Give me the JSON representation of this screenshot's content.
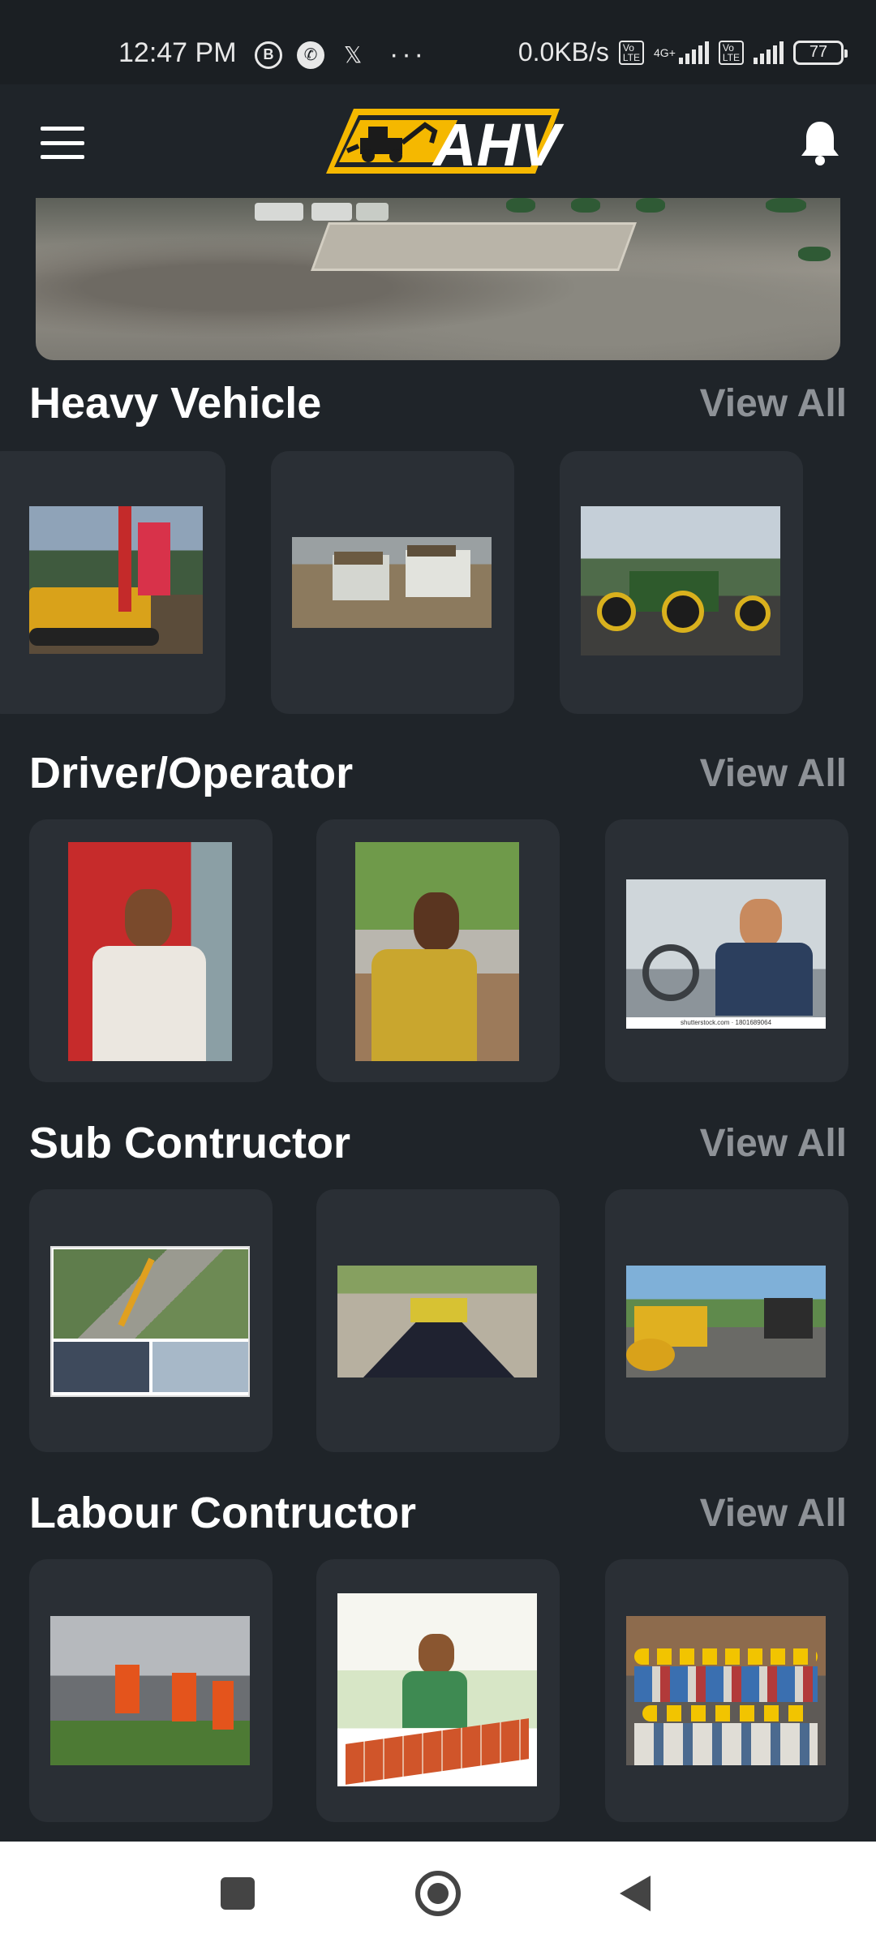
{
  "status_bar": {
    "time": "12:47 PM",
    "net_speed": "0.0KB/s",
    "network_type": "4G+",
    "lte_badge": "Vo LTE",
    "battery": "77",
    "icons": [
      "b-circle-icon",
      "phone-call-icon",
      "x-logo-icon",
      "more-dots-icon"
    ]
  },
  "header": {
    "logo_text": "AHV",
    "icons": [
      "menu-icon",
      "bell-icon"
    ]
  },
  "sections": [
    {
      "title": "Heavy Vehicle",
      "view_all": "View All",
      "cards": [
        "piling-rig-photo",
        "dump-trucks-photo",
        "tractor-photo"
      ]
    },
    {
      "title": "Driver/Operator",
      "view_all": "View All",
      "cards": [
        "driver-portrait-photo-1",
        "driver-portrait-photo-2",
        "truck-driver-photo"
      ],
      "watermark": "shutterstock.com · 1801689064"
    },
    {
      "title": "Sub Contructor",
      "view_all": "View All",
      "cards": [
        "bridge-construction-collage-photo",
        "road-paving-photo",
        "road-roller-photo"
      ]
    },
    {
      "title": "Labour Contructor",
      "view_all": "View All",
      "cards": [
        "road-workers-photo",
        "brick-layer-photo",
        "worker-group-photo"
      ]
    }
  ],
  "colors": {
    "background": "#1f2429",
    "card": "#2a2f35",
    "accent_yellow": "#f5b800",
    "view_all": "#8e9297"
  }
}
